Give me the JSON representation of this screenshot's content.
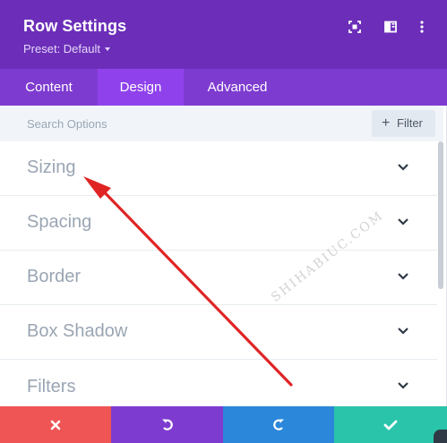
{
  "header": {
    "title": "Row Settings",
    "preset": "Preset: Default",
    "icons": [
      "expand-icon",
      "split-view-icon",
      "more-options-icon"
    ]
  },
  "tabs": [
    {
      "label": "Content",
      "active": false
    },
    {
      "label": "Design",
      "active": true
    },
    {
      "label": "Advanced",
      "active": false
    }
  ],
  "search": {
    "placeholder": "Search Options",
    "value": "",
    "filter_label": "Filter"
  },
  "sections": [
    {
      "label": "Sizing"
    },
    {
      "label": "Spacing"
    },
    {
      "label": "Border"
    },
    {
      "label": "Box Shadow"
    },
    {
      "label": "Filters"
    }
  ],
  "actions": [
    {
      "name": "cancel",
      "icon": "close-icon",
      "color": "#ef5555"
    },
    {
      "name": "undo",
      "icon": "undo-icon",
      "color": "#7e3bd0"
    },
    {
      "name": "redo",
      "icon": "redo-icon",
      "color": "#2b87da"
    },
    {
      "name": "save",
      "icon": "check-icon",
      "color": "#29c4a9"
    }
  ],
  "colors": {
    "header": "#6c2eb9",
    "tab_bar": "#7e3bd0",
    "tab_active": "#8f42ec",
    "annotation_arrow": "#e02424"
  },
  "watermark": "SHIHABIUC.COM"
}
